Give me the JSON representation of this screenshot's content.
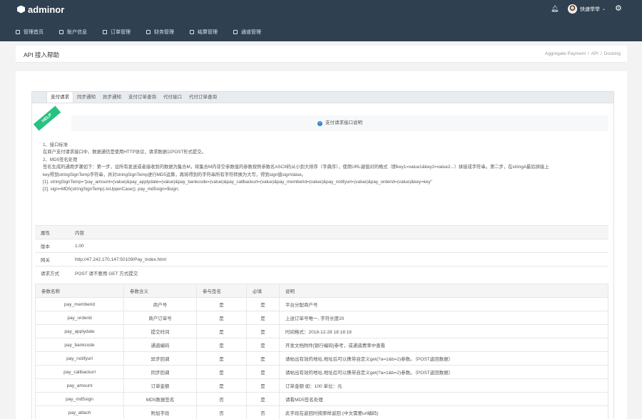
{
  "brand": {
    "name": "adminor"
  },
  "user": {
    "name": "快速举举"
  },
  "nav": [
    {
      "label": "管理首页"
    },
    {
      "label": "账户信息"
    },
    {
      "label": "订单管理"
    },
    {
      "label": "财务管理"
    },
    {
      "label": "结算管理"
    },
    {
      "label": "通道管理"
    }
  ],
  "page": {
    "title": "API 接入帮助",
    "breadcrumb": [
      "Aggregate Payment",
      "API",
      "Docking"
    ]
  },
  "tabs": [
    "支付请求",
    "同步通知",
    "异步通知",
    "支付订单查询",
    "代付接口",
    "代付订单查询"
  ],
  "ribbon": "HELP",
  "notice": "支付请求接口说明",
  "description": [
    "1、接口标准",
    "在商户支付请求接口中，数据通信是使用HTTP协议，请求数据以POST形式提交。",
    "2、MD5签名处理",
    "签名生成的通用步骤如下：第一步，设所有发送或者接收到的数据为集合M，将集合M内非空参数值的参数按照参数名ASCII码从小到大排序（字典序），使用URL键值对的格式（即key1=value1&key2=value2...）拼接成字符串。第二步，在stringA最后拼接上",
    "key得到stringSignTemp字符串，并对stringSignTemp进行MD5运算，再将得到的字符串所有字符转换为大写，得到sign值signValue。",
    "[1]. stringSignTemp=\"pay_amount=(value)&pay_applydate=(value)&pay_bankcode=(value)&pay_callbackurl=(value)&pay_memberid=(value)&pay_notifyurl=(value)&pay_orderid=(value)&key=key\"",
    "[2]. sign=MD5(stringSignTemp).toUpperCase(); pay_md5sign=$sign;"
  ],
  "info_table": {
    "header": [
      "属性",
      "内容"
    ],
    "rows": [
      [
        "版本",
        "1.00"
      ],
      [
        "网关",
        "http://47.242.170.147:50109/Pay_Index.html"
      ],
      [
        "请求方式",
        "POST 请不要用 GET 方式提交"
      ]
    ]
  },
  "param_table": {
    "header": [
      "参数名称",
      "参数含义",
      "参与签名",
      "必填",
      "说明"
    ],
    "rows": [
      [
        "pay_memberid",
        "商户号",
        "是",
        "是",
        "平台分配商户号"
      ],
      [
        "pay_orderid",
        "商户订单号",
        "是",
        "是",
        "上送订单号唯一, 字符长度20"
      ],
      [
        "pay_applydate",
        "提交时间",
        "是",
        "是",
        "时间格式：2018-12-28 18:18:18"
      ],
      [
        "pay_bankcode",
        "通道编码",
        "是",
        "是",
        "开发文档附件[银行编码]参考，或通道费率中查看"
      ],
      [
        "pay_notifyurl",
        "异步回调",
        "是",
        "是",
        "请帖出有效的地址,地址后可以携带自定义get(?a=1&b=2)参数。（POST返回数据）"
      ],
      [
        "pay_callbackurl",
        "同步回调",
        "是",
        "是",
        "请帖出有效的地址,地址后可以携带自定义get(?a=1&b=2)参数。（POST返回数据）"
      ],
      [
        "pay_amount",
        "订单金额",
        "是",
        "是",
        "订单金额 如：100 单位：元"
      ],
      [
        "pay_md5sign",
        "MD5数据签名",
        "否",
        "是",
        "请看MD5签名处理"
      ],
      [
        "pay_attach",
        "附加字段",
        "否",
        "否",
        "此字段在返回时按原样返回 (中文需要url编码)"
      ]
    ]
  }
}
